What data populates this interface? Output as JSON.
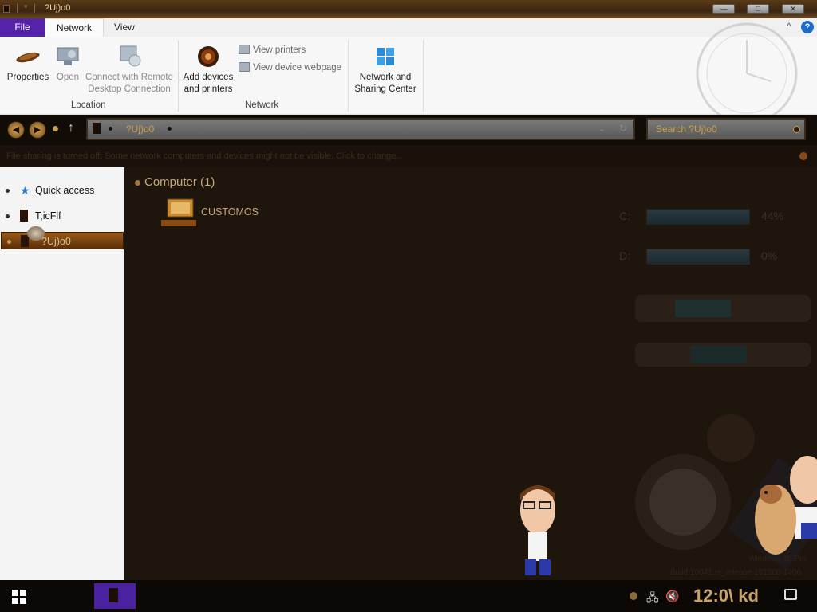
{
  "window": {
    "title": "?Uj)o0",
    "min_label": "—",
    "max_label": "□",
    "close_label": "✕"
  },
  "ribbon_tabs": [
    "File",
    "Network",
    "View"
  ],
  "ribbon": {
    "properties": "Properties",
    "open": "Open",
    "connect_remote": [
      "Connect with Remote",
      "Desktop Connection"
    ],
    "location_group": "Location",
    "add_devices": [
      "Add devices",
      "and printers"
    ],
    "view_printers": "View printers",
    "view_device_webpage": "View device webpage",
    "network_group": "Network",
    "network_sharing": [
      "Network and",
      "Sharing Center"
    ],
    "collapse_icon": "^",
    "help_icon": "?"
  },
  "address": {
    "path": "?Uj)o0",
    "search_placeholder": "Search ?Uj)o0"
  },
  "infobar": {
    "text": "File sharing is turned off. Some network computers and devices might not be visible. Click to change..."
  },
  "navpane": {
    "items": [
      {
        "label": "Quick access"
      },
      {
        "label": "T;icFlf"
      },
      {
        "label": "?Uj)o0"
      }
    ]
  },
  "content": {
    "section_header": "Computer (1)",
    "computer_name": "CUSTOMOS",
    "drives": [
      {
        "label": "C:",
        "percent": "44%"
      },
      {
        "label": "D:",
        "percent": "0%"
      }
    ],
    "watermark": [
      "Windows 10 Pro",
      "Build 10041.rs_release.191308-1406"
    ]
  },
  "taskbar": {
    "time": "12:0\\ kd"
  },
  "colors": {
    "accent": "#5522aa",
    "brass": "#c8a068",
    "background": "#1e150d"
  }
}
